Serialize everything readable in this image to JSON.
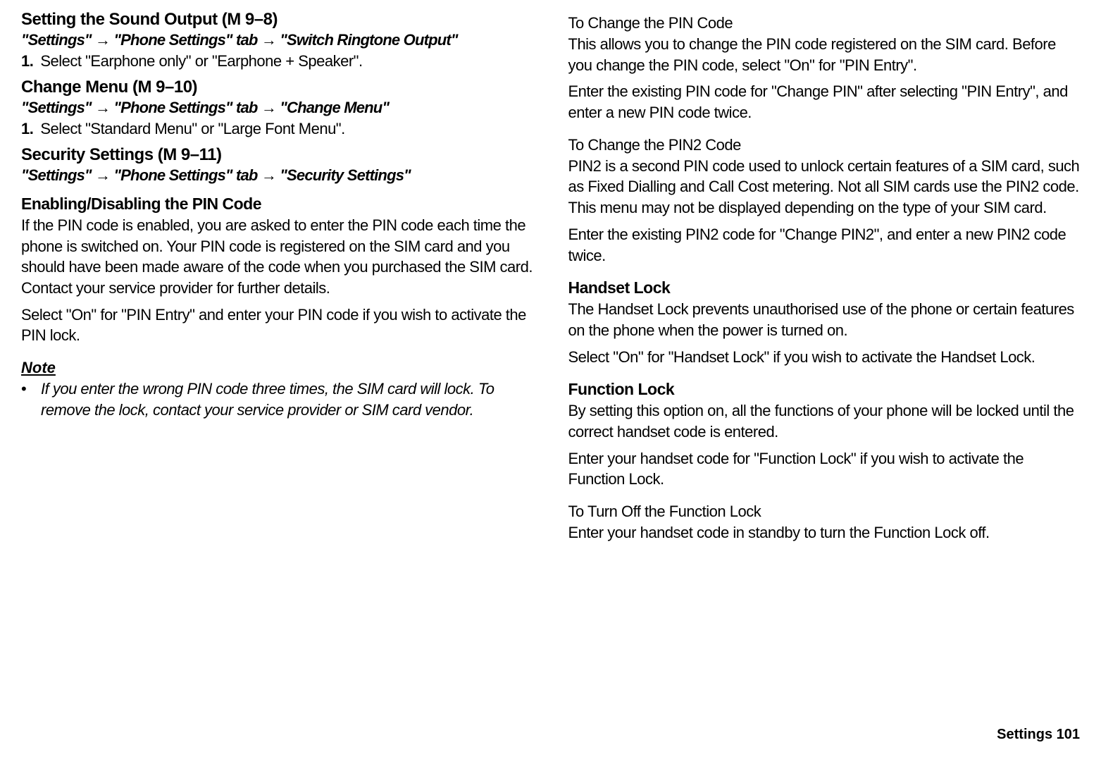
{
  "left": {
    "section1": {
      "heading": "Setting the Sound Output (M 9–8)",
      "navPath": "\"Settings\" → \"Phone Settings\" tab → \"Switch Ringtone Output\"",
      "step1Num": "1.",
      "step1Text": "Select \"Earphone only\" or \"Earphone + Speaker\"."
    },
    "section2": {
      "heading": "Change Menu (M 9–10)",
      "navPath": "\"Settings\" → \"Phone Settings\" tab → \"Change Menu\"",
      "step1Num": "1.",
      "step1Text": "Select \"Standard Menu\" or \"Large Font Menu\"."
    },
    "section3": {
      "heading": "Security Settings (M 9–11)",
      "navPath": "\"Settings\" → \"Phone Settings\" tab → \"Security Settings\"",
      "subheading": "Enabling/Disabling the PIN Code",
      "para1": "If the PIN code is enabled, you are asked to enter the PIN code each time the phone is switched on. Your PIN code is registered on the SIM card and you should have been made aware of the code when you purchased the SIM card. Contact your service provider for further details.",
      "para2": "Select \"On\" for \"PIN Entry\" and enter your PIN code if you wish to activate the PIN lock.",
      "noteLabel": "Note",
      "noteBullet": "•",
      "noteText": "If you enter the wrong PIN code three times, the SIM card will lock. To remove the lock, contact your service provider or SIM card vendor."
    }
  },
  "right": {
    "section1": {
      "heading": "To Change the PIN Code",
      "para1": "This allows you to change the PIN code registered on the SIM card. Before you change the PIN code, select \"On\" for \"PIN Entry\".",
      "para2": "Enter the existing PIN code for \"Change PIN\" after selecting \"PIN Entry\", and enter a new PIN code twice."
    },
    "section2": {
      "heading": "To Change the PIN2 Code",
      "para1": "PIN2 is a second PIN code used to unlock certain features of a SIM card, such as Fixed Dialling and Call Cost metering. Not all SIM cards use the PIN2 code. This menu may not be displayed depending on the type of your SIM card.",
      "para2": "Enter the existing PIN2 code for \"Change PIN2\", and enter a new PIN2 code twice."
    },
    "section3": {
      "heading": "Handset Lock",
      "para1": "The Handset Lock prevents unauthorised use of the phone or certain features on the phone when the power is turned on.",
      "para2": "Select \"On\" for \"Handset Lock\" if you wish to activate the Handset Lock."
    },
    "section4": {
      "heading": "Function Lock",
      "para1": "By setting this option on, all the functions of your phone will be locked until the correct handset code is entered.",
      "para2": "Enter your handset code for \"Function Lock\" if you wish to activate the Function Lock."
    },
    "section5": {
      "heading": "To Turn Off the Function Lock",
      "para1": "Enter your handset code in standby to turn the Function Lock off."
    }
  },
  "footer": "Settings  101"
}
